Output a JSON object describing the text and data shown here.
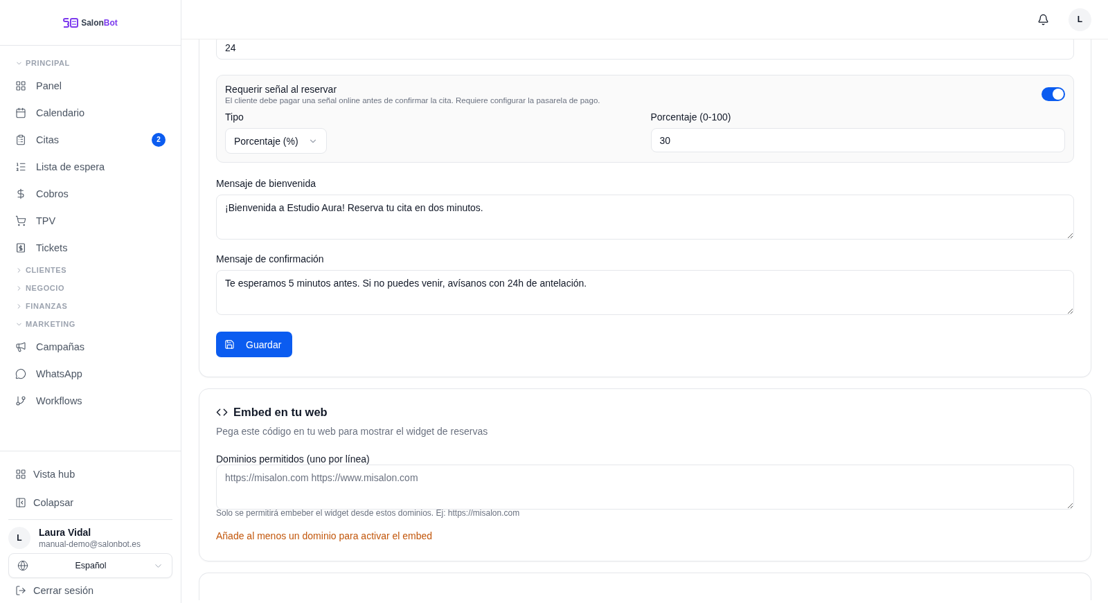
{
  "brand": {
    "prefix": "Salon",
    "suffix": "Bot"
  },
  "sidebar": {
    "sections": [
      {
        "label": "PRINCIPAL",
        "expanded": true,
        "items": [
          {
            "label": "Panel",
            "selected": false
          },
          {
            "label": "Calendario",
            "selected": false
          },
          {
            "label": "Citas",
            "selected": false,
            "badge": "2"
          },
          {
            "label": "Lista de espera",
            "selected": false
          },
          {
            "label": "Cobros",
            "selected": false
          },
          {
            "label": "TPV",
            "selected": false
          },
          {
            "label": "Tickets",
            "selected": false
          }
        ]
      },
      {
        "label": "CLIENTES",
        "expanded": false
      },
      {
        "label": "NEGOCIO",
        "expanded": false
      },
      {
        "label": "FINANZAS",
        "expanded": false
      },
      {
        "label": "MARKETING",
        "expanded": true,
        "items": [
          {
            "label": "Campañas",
            "selected": false
          },
          {
            "label": "WhatsApp",
            "selected": false
          },
          {
            "label": "Workflows",
            "selected": false
          }
        ]
      }
    ],
    "footer_items": [
      {
        "label": "Vista hub"
      },
      {
        "label": "Colapsar"
      }
    ],
    "user": {
      "initial": "L",
      "name": "Laura Vidal",
      "email": "manual-demo@salonbot.es"
    },
    "language": "Español",
    "logout": "Cerrar sesión"
  },
  "header": {
    "avatar_initial": "L"
  },
  "settings_card": {
    "top_field_value": "24",
    "deposit": {
      "title": "Requerir señal al reservar",
      "description": "El cliente debe pagar una señal online antes de confirmar la cita. Requiere configurar la pasarela de pago.",
      "on": true,
      "type_label": "Tipo",
      "type_value": "Porcentaje (%)",
      "percent_label": "Porcentaje (0-100)",
      "percent_value": "30"
    },
    "welcome": {
      "label": "Mensaje de bienvenida",
      "value": "¡Bienvenida a Estudio Aura! Reserva tu cita en dos minutos."
    },
    "confirmation": {
      "label": "Mensaje de confirmación",
      "value": "Te esperamos 5 minutos antes. Si no puedes venir, avísanos con 24h de antelación."
    },
    "save_button": "Guardar"
  },
  "embed_card": {
    "title": "Embed en tu web",
    "description": "Pega este código en tu web para mostrar el widget de reservas",
    "domains_label": "Dominios permitidos (uno por línea)",
    "domains_placeholder": "https://misalon.com https://www.misalon.com",
    "hint": "Solo se permitirá embeber el widget desde estos dominios. Ej: https://misalon.com",
    "warning": "Añade al menos un dominio para activar el embed"
  }
}
